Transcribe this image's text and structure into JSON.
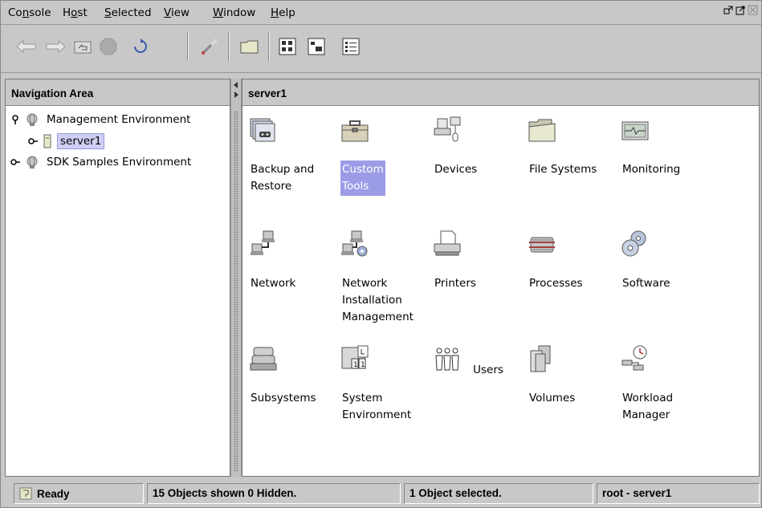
{
  "menubar": {
    "items": [
      {
        "label": "Console",
        "mnemonic_index": 2
      },
      {
        "label": "Host",
        "mnemonic_index": 1
      },
      {
        "label": "Selected",
        "mnemonic_index": 0
      },
      {
        "label": "View",
        "mnemonic_index": 0
      },
      {
        "label": "Window",
        "mnemonic_index": 0
      },
      {
        "label": "Help",
        "mnemonic_index": 0
      }
    ]
  },
  "toolbar": {
    "buttons": [
      "back-arrow-icon",
      "forward-arrow-icon",
      "up-folder-icon",
      "stop-icon",
      "refresh-icon",
      "find-icon",
      "open-folder-icon",
      "large-icons-view-icon",
      "small-icons-view-icon",
      "details-view-icon"
    ]
  },
  "navigation": {
    "title": "Navigation Area",
    "tree": [
      {
        "label": "Management Environment",
        "expanded": true,
        "level": 0,
        "icon": "globe-icon"
      },
      {
        "label": "server1",
        "expanded": false,
        "level": 1,
        "icon": "server-icon",
        "selected": true
      },
      {
        "label": "SDK Samples Environment",
        "expanded": false,
        "level": 0,
        "icon": "globe-icon"
      }
    ]
  },
  "content": {
    "title": "server1",
    "tiles": [
      {
        "label": "Backup and\nRestore",
        "icon": "backup-restore-icon",
        "selected": false
      },
      {
        "label": "Custom\nTools",
        "icon": "toolbox-icon",
        "selected": true
      },
      {
        "label": "Devices",
        "icon": "devices-icon",
        "selected": false
      },
      {
        "label": "File Systems",
        "icon": "folder-icon",
        "selected": false
      },
      {
        "label": "Monitoring",
        "icon": "monitor-icon",
        "selected": false
      },
      {
        "label": "Network",
        "icon": "network-icon",
        "selected": false
      },
      {
        "label": "Network\nInstallation\nManagement",
        "icon": "network-install-icon",
        "selected": false
      },
      {
        "label": "Printers",
        "icon": "printer-icon",
        "selected": false
      },
      {
        "label": "Processes",
        "icon": "processes-icon",
        "selected": false
      },
      {
        "label": "Software",
        "icon": "software-icon",
        "selected": false
      },
      {
        "label": "Subsystems",
        "icon": "subsystems-icon",
        "selected": false
      },
      {
        "label": "System\nEnvironment",
        "icon": "system-environment-icon",
        "selected": false
      },
      {
        "label": "Users",
        "icon": "users-icon",
        "selected": false
      },
      {
        "label": "Volumes",
        "icon": "volumes-icon",
        "selected": false
      },
      {
        "label": "Workload\nManager",
        "icon": "workload-manager-icon",
        "selected": false
      }
    ]
  },
  "status": {
    "ready": "Ready",
    "objects": "15 Objects shown 0 Hidden.",
    "selected": "1 Object selected.",
    "host": "root - server1"
  },
  "colors": {
    "selection": "#9c9ce6",
    "tree_selection": "#cfcff5",
    "chrome": "#c8c8c8"
  }
}
